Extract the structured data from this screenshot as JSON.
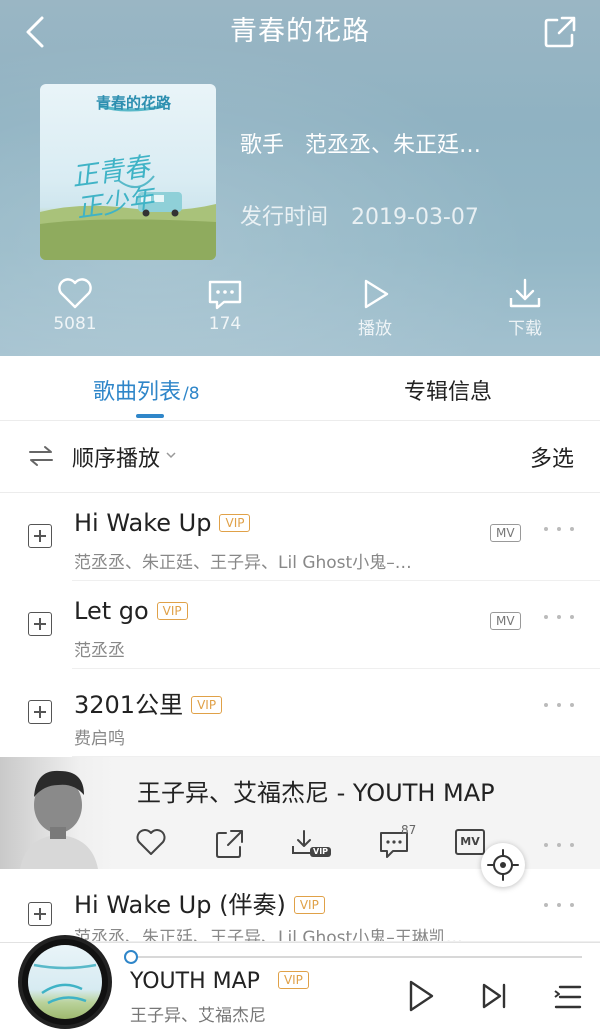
{
  "nav": {
    "title": "青春的花路"
  },
  "album": {
    "cover_text_top": "青春的花路",
    "cover_text_main": "正青春 正少年",
    "singer_label": "歌手",
    "singer": "范丞丞、朱正廷…",
    "date_label": "发行时间",
    "date": "2019-03-07"
  },
  "actions": [
    {
      "icon": "heart-icon",
      "label": "5081"
    },
    {
      "icon": "comment-icon",
      "label": "174"
    },
    {
      "icon": "play-icon",
      "label": "播放"
    },
    {
      "icon": "download-icon",
      "label": "下载"
    }
  ],
  "tabs": {
    "songs_label": "歌曲列表",
    "songs_count": "/8",
    "info_label": "专辑信息"
  },
  "playmode": {
    "order_label": "顺序播放",
    "multi_label": "多选"
  },
  "songs": [
    {
      "title": "Hi Wake Up",
      "vip": "VIP",
      "artist": "范丞丞、朱正廷、王子异、Lil Ghost小鬼–…",
      "mv": "MV"
    },
    {
      "title": "Let go",
      "vip": "VIP",
      "artist": "范丞丞",
      "mv": "MV"
    },
    {
      "title": "3201公里",
      "vip": "VIP",
      "artist": "费启鸣",
      "mv": ""
    },
    {
      "title": "Hi Wake Up (伴奏)",
      "vip": "VIP",
      "artist": "范丞丞、朱正廷、王子异、Lil Ghost小鬼–王琳凯…",
      "mv": ""
    }
  ],
  "expanded": {
    "title": "王子异、艾福杰尼 - YOUTH MAP",
    "comment_count": "87",
    "dl_badge": "VIP",
    "mv_badge": "MV"
  },
  "player": {
    "title": "YOUTH MAP",
    "vip": "VIP",
    "artist": "王子异、艾福杰尼",
    "progress": 0.0
  },
  "colors": {
    "accent": "#2f86c9",
    "vip": "#e0a148"
  }
}
